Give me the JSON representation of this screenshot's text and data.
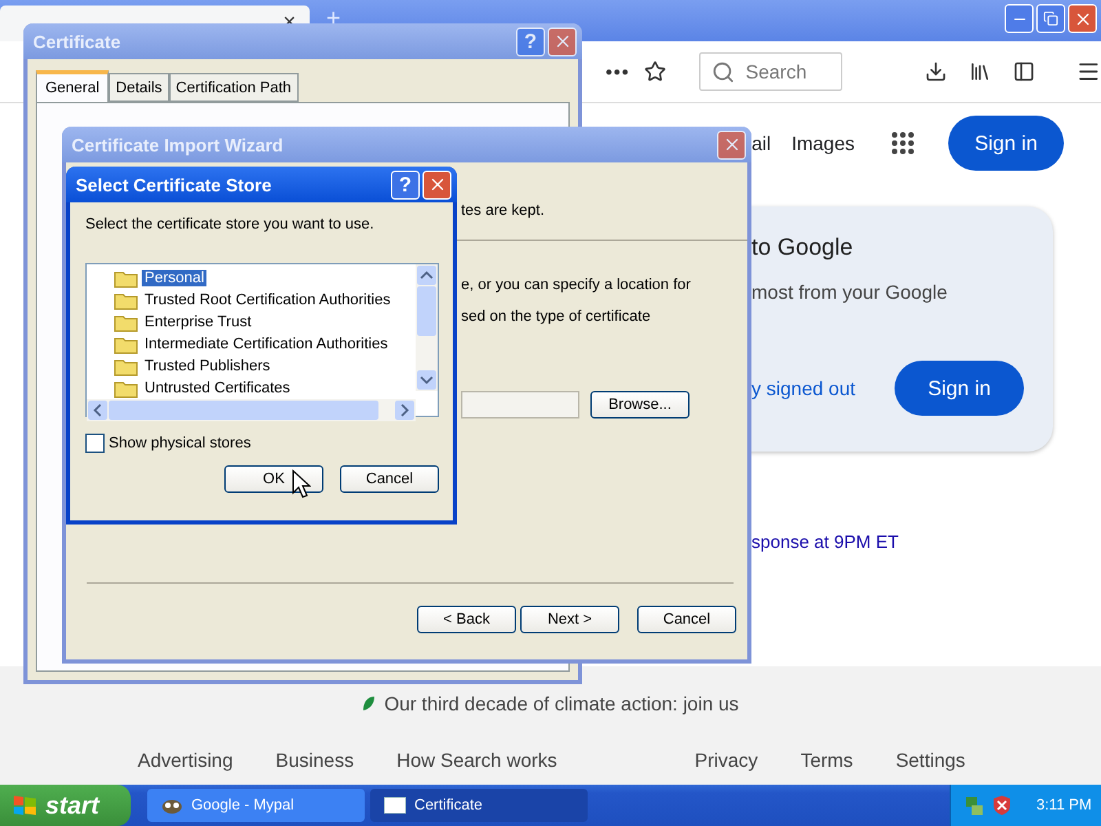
{
  "browser": {
    "tab_close": "×",
    "new_tab": "+",
    "toolbar": {
      "more": "•••",
      "search_placeholder": "Search"
    }
  },
  "google": {
    "header_links": [
      "ail",
      "Images"
    ],
    "sign_in": "Sign in",
    "card": {
      "title": "to Google",
      "text": "most from your Google",
      "link": "y signed out",
      "button": "Sign in"
    },
    "notice": "sponse at 9PM ET",
    "climate": "Our third decade of climate action: join us",
    "footer_left": [
      "Advertising",
      "Business",
      "How Search works"
    ],
    "footer_right": [
      "Privacy",
      "Terms",
      "Settings"
    ]
  },
  "certificate_window": {
    "title": "Certificate",
    "help": "?",
    "tabs": [
      {
        "label": "General",
        "selected": true
      },
      {
        "label": "Details",
        "selected": false
      },
      {
        "label": "Certification Path",
        "selected": false
      }
    ]
  },
  "wizard": {
    "title": "Certificate Import Wizard",
    "lines": [
      "tes are kept.",
      "e, or you can specify a location for",
      "sed on the type of certificate"
    ],
    "browse": "Browse...",
    "buttons": [
      "< Back",
      "Next >",
      "Cancel"
    ]
  },
  "store_dialog": {
    "title": "Select Certificate Store",
    "help": "?",
    "prompt": "Select the certificate store you want to use.",
    "stores": [
      {
        "label": "Personal",
        "selected": true
      },
      {
        "label": "Trusted Root Certification Authorities",
        "selected": false
      },
      {
        "label": "Enterprise Trust",
        "selected": false
      },
      {
        "label": "Intermediate Certification Authorities",
        "selected": false
      },
      {
        "label": "Trusted Publishers",
        "selected": false
      },
      {
        "label": "Untrusted Certificates",
        "selected": false
      }
    ],
    "show_physical": {
      "label": "Show physical stores",
      "checked": false
    },
    "buttons": [
      "OK",
      "Cancel"
    ]
  },
  "taskbar": {
    "start": "start",
    "tasks": [
      {
        "label": "Google - Mypal",
        "selected": false
      },
      {
        "label": "Certificate",
        "selected": true
      }
    ],
    "clock": "3:11 PM"
  }
}
